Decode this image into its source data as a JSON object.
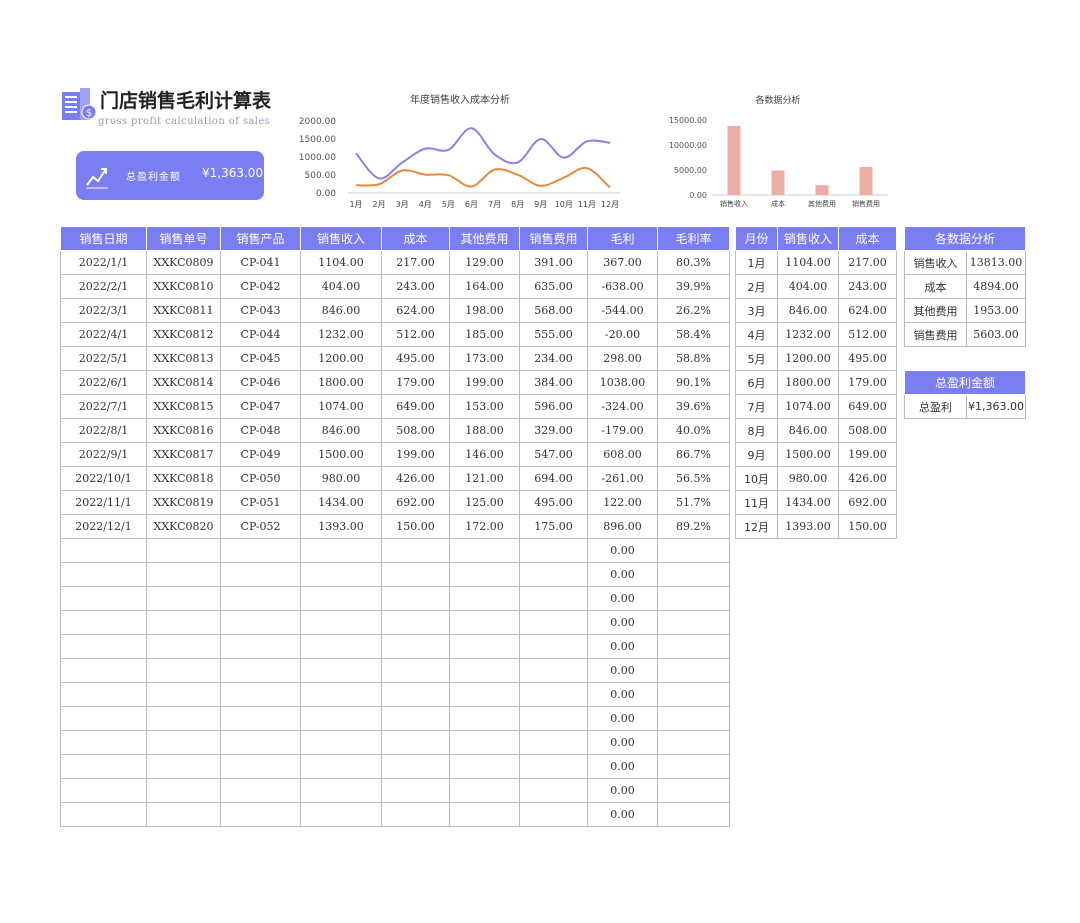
{
  "header": {
    "title": "门店销售毛利计算表",
    "subtitle": "gross profit calculation of sales"
  },
  "summary_card": {
    "label": "总盈利金额",
    "value": "¥1,363.00",
    "icon": "trend-up-icon"
  },
  "colors": {
    "accent": "#7b7ef2",
    "income_line": "#8a82e6",
    "cost_line": "#e68a3c",
    "bar": "#ebada6"
  },
  "chart_data": [
    {
      "type": "line",
      "title": "年度销售收入成本分析",
      "categories": [
        "1月",
        "2月",
        "3月",
        "4月",
        "5月",
        "6月",
        "7月",
        "8月",
        "9月",
        "10月",
        "11月",
        "12月"
      ],
      "series": [
        {
          "values": [
            1104,
            404,
            846,
            1232,
            1200,
            1800,
            1074,
            846,
            1500,
            980,
            1434,
            1393
          ]
        },
        {
          "values": [
            217,
            243,
            624,
            512,
            495,
            179,
            649,
            508,
            199,
            426,
            692,
            150
          ]
        }
      ],
      "yticks": [
        "2000.00",
        "1500.00",
        "1000.00",
        "500.00",
        "0.00"
      ],
      "ylim": [
        0,
        2000
      ],
      "grid": false
    },
    {
      "type": "bar",
      "title": "各数据分析",
      "categories": [
        "销售收入",
        "成本",
        "其他费用",
        "销售费用"
      ],
      "values": [
        13813,
        4894,
        1953,
        5603
      ],
      "yticks": [
        "15000.00",
        "10000.00",
        "5000.00",
        "0.00"
      ],
      "ylim": [
        0,
        15000
      ],
      "grid": false
    }
  ],
  "main_table": {
    "headers": [
      "销售日期",
      "销售单号",
      "销售产品",
      "销售收入",
      "成本",
      "其他费用",
      "销售费用",
      "毛利",
      "毛利率"
    ],
    "rows": [
      [
        "2022/1/1",
        "XXKC0809",
        "CP-041",
        "1104.00",
        "217.00",
        "129.00",
        "391.00",
        "367.00",
        "80.3%"
      ],
      [
        "2022/2/1",
        "XXKC0810",
        "CP-042",
        "404.00",
        "243.00",
        "164.00",
        "635.00",
        "-638.00",
        "39.9%"
      ],
      [
        "2022/3/1",
        "XXKC0811",
        "CP-043",
        "846.00",
        "624.00",
        "198.00",
        "568.00",
        "-544.00",
        "26.2%"
      ],
      [
        "2022/4/1",
        "XXKC0812",
        "CP-044",
        "1232.00",
        "512.00",
        "185.00",
        "555.00",
        "-20.00",
        "58.4%"
      ],
      [
        "2022/5/1",
        "XXKC0813",
        "CP-045",
        "1200.00",
        "495.00",
        "173.00",
        "234.00",
        "298.00",
        "58.8%"
      ],
      [
        "2022/6/1",
        "XXKC0814",
        "CP-046",
        "1800.00",
        "179.00",
        "199.00",
        "384.00",
        "1038.00",
        "90.1%"
      ],
      [
        "2022/7/1",
        "XXKC0815",
        "CP-047",
        "1074.00",
        "649.00",
        "153.00",
        "596.00",
        "-324.00",
        "39.6%"
      ],
      [
        "2022/8/1",
        "XXKC0816",
        "CP-048",
        "846.00",
        "508.00",
        "188.00",
        "329.00",
        "-179.00",
        "40.0%"
      ],
      [
        "2022/9/1",
        "XXKC0817",
        "CP-049",
        "1500.00",
        "199.00",
        "146.00",
        "547.00",
        "608.00",
        "86.7%"
      ],
      [
        "2022/10/1",
        "XXKC0818",
        "CP-050",
        "980.00",
        "426.00",
        "121.00",
        "694.00",
        "-261.00",
        "56.5%"
      ],
      [
        "2022/11/1",
        "XXKC0819",
        "CP-051",
        "1434.00",
        "692.00",
        "125.00",
        "495.00",
        "122.00",
        "51.7%"
      ],
      [
        "2022/12/1",
        "XXKC0820",
        "CP-052",
        "1393.00",
        "150.00",
        "172.00",
        "175.00",
        "896.00",
        "89.2%"
      ],
      [
        "",
        "",
        "",
        "",
        "",
        "",
        "",
        "0.00",
        ""
      ],
      [
        "",
        "",
        "",
        "",
        "",
        "",
        "",
        "0.00",
        ""
      ],
      [
        "",
        "",
        "",
        "",
        "",
        "",
        "",
        "0.00",
        ""
      ],
      [
        "",
        "",
        "",
        "",
        "",
        "",
        "",
        "0.00",
        ""
      ],
      [
        "",
        "",
        "",
        "",
        "",
        "",
        "",
        "0.00",
        ""
      ],
      [
        "",
        "",
        "",
        "",
        "",
        "",
        "",
        "0.00",
        ""
      ],
      [
        "",
        "",
        "",
        "",
        "",
        "",
        "",
        "0.00",
        ""
      ],
      [
        "",
        "",
        "",
        "",
        "",
        "",
        "",
        "0.00",
        ""
      ],
      [
        "",
        "",
        "",
        "",
        "",
        "",
        "",
        "0.00",
        ""
      ],
      [
        "",
        "",
        "",
        "",
        "",
        "",
        "",
        "0.00",
        ""
      ],
      [
        "",
        "",
        "",
        "",
        "",
        "",
        "",
        "0.00",
        ""
      ],
      [
        "",
        "",
        "",
        "",
        "",
        "",
        "",
        "0.00",
        ""
      ]
    ]
  },
  "month_table": {
    "headers": [
      "月份",
      "销售收入",
      "成本"
    ],
    "rows": [
      [
        "1月",
        "1104.00",
        "217.00"
      ],
      [
        "2月",
        "404.00",
        "243.00"
      ],
      [
        "3月",
        "846.00",
        "624.00"
      ],
      [
        "4月",
        "1232.00",
        "512.00"
      ],
      [
        "5月",
        "1200.00",
        "495.00"
      ],
      [
        "6月",
        "1800.00",
        "179.00"
      ],
      [
        "7月",
        "1074.00",
        "649.00"
      ],
      [
        "8月",
        "846.00",
        "508.00"
      ],
      [
        "9月",
        "1500.00",
        "199.00"
      ],
      [
        "10月",
        "980.00",
        "426.00"
      ],
      [
        "11月",
        "1434.00",
        "692.00"
      ],
      [
        "12月",
        "1393.00",
        "150.00"
      ]
    ]
  },
  "analysis_table": {
    "header": "各数据分析",
    "rows": [
      [
        "销售收入",
        "13813.00"
      ],
      [
        "成本",
        "4894.00"
      ],
      [
        "其他费用",
        "1953.00"
      ],
      [
        "销售费用",
        "5603.00"
      ]
    ]
  },
  "profit_table": {
    "header": "总盈利金额",
    "rows": [
      [
        "总盈利",
        "¥1,363.00"
      ]
    ]
  }
}
